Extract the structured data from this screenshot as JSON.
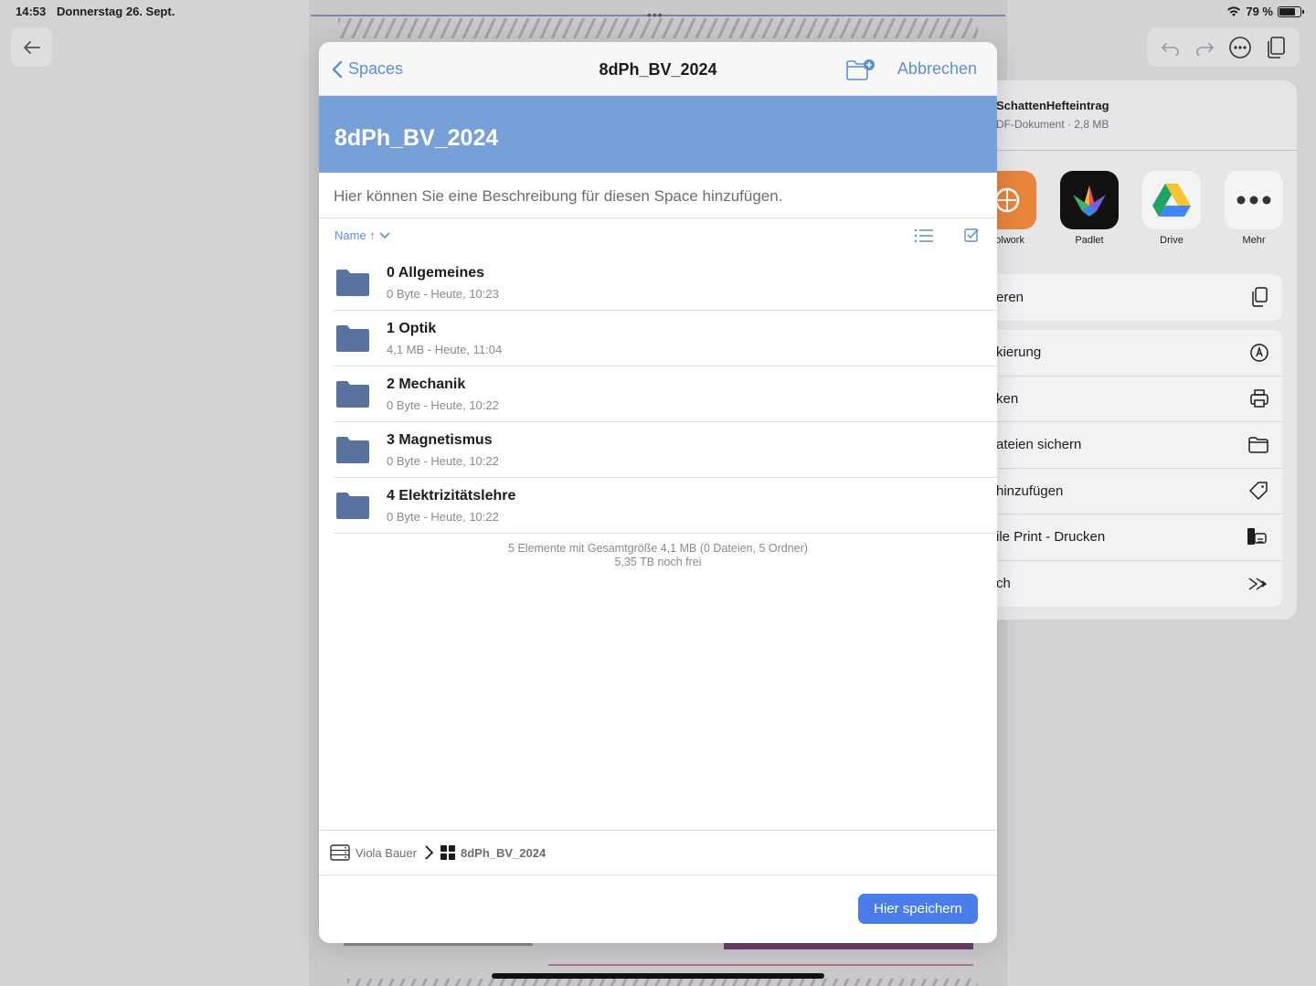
{
  "status": {
    "time": "14:53",
    "date": "Donnerstag 26. Sept.",
    "battery": "79 %",
    "battery_level": 0.79
  },
  "share_sheet": {
    "file_title": "SchattenHefteintrag",
    "file_sub": "DF-Dokument · 2,8 MB",
    "apps": [
      {
        "label": "oolwork",
        "icon": "toolwork-icon"
      },
      {
        "label": "Padlet",
        "icon": "padlet-icon"
      },
      {
        "label": "Drive",
        "icon": "drive-icon"
      },
      {
        "label": "Mehr",
        "icon": "more-icon"
      }
    ],
    "actions_group1": [
      {
        "label": "eren",
        "icon": "copy-icon"
      }
    ],
    "actions_group2": [
      {
        "label": "kierung",
        "icon": "markup-icon"
      },
      {
        "label": "ken",
        "icon": "print-icon"
      },
      {
        "label": "ateien sichern",
        "icon": "folder-icon"
      },
      {
        "label": " hinzufügen",
        "icon": "tag-icon"
      },
      {
        "label": "ile Print - Drucken",
        "icon": "mobile-print-icon"
      },
      {
        "label": "ch",
        "icon": "forward-icon"
      }
    ]
  },
  "modal": {
    "back_label": "Spaces",
    "title": "8dPh_BV_2024",
    "cancel_label": "Abbrechen",
    "banner_title": "8dPh_BV_2024",
    "description_placeholder": "Hier können Sie eine Beschreibung für diesen Space hinzufügen.",
    "sort_label": "Name ↑",
    "files": [
      {
        "name": "0 Allgemeines",
        "meta": "0 Byte - Heute, 10:23"
      },
      {
        "name": "1 Optik",
        "meta": "4,1 MB - Heute, 11:04"
      },
      {
        "name": "2 Mechanik",
        "meta": "0 Byte - Heute, 10:22"
      },
      {
        "name": "3 Magnetismus",
        "meta": "0 Byte - Heute, 10:22"
      },
      {
        "name": "4 Elektrizitätslehre",
        "meta": "0 Byte - Heute, 10:22"
      }
    ],
    "summary_line1": "5 Elemente mit Gesamtgröße 4,1 MB (0 Dateien, 5 Ordner)",
    "summary_line2": "5,35 TB noch frei",
    "breadcrumb_user": "Viola Bauer",
    "breadcrumb_space": "8dPh_BV_2024",
    "save_label": "Hier speichern"
  },
  "colors": {
    "accent": "#5b8fd6",
    "banner": "#77a0d8",
    "folder": "#5a739e",
    "save_button": "#4a7dea"
  }
}
